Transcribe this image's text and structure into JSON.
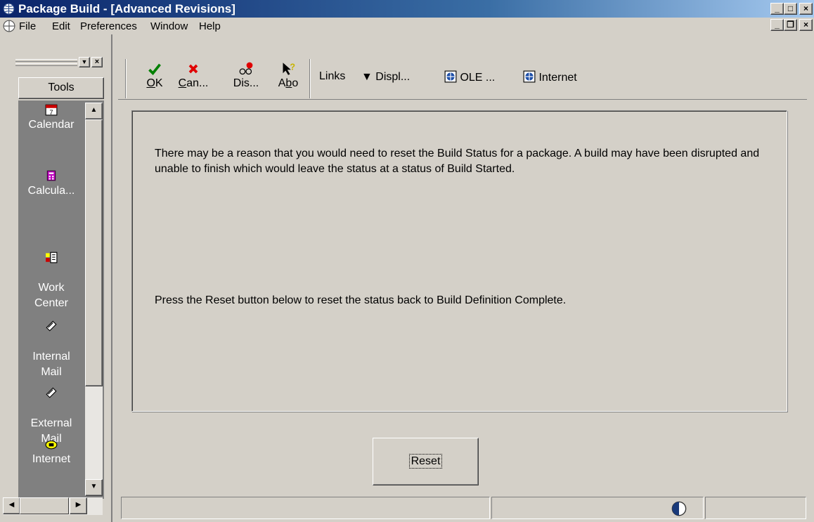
{
  "window": {
    "title": "Package Build - [Advanced Revisions]",
    "minimize_glyph": "_",
    "maximize_glyph": "□",
    "close_glyph": "×",
    "restore_glyph": "❐",
    "title_icon": "globe-icon"
  },
  "menu": {
    "items": [
      "File",
      "Edit",
      "Preferences",
      "Window",
      "Help"
    ]
  },
  "tools": {
    "header": "Tools",
    "items": [
      {
        "label": "Calendar",
        "icon": "calendar-icon"
      },
      {
        "label": "Calcula...",
        "icon": "calculator-icon"
      },
      {
        "label": "Work\nCenter",
        "icon": "work-center-icon"
      },
      {
        "label": "Internal\nMail",
        "icon": "mail-icon"
      },
      {
        "label": "External\nMail",
        "icon": "mail-icon"
      },
      {
        "label": "Internet",
        "icon": "phone-icon"
      }
    ]
  },
  "toolbar": {
    "ok": {
      "prefix": "",
      "mnemonic": "O",
      "rest": "K"
    },
    "cancel": {
      "prefix": "",
      "mnemonic": "C",
      "rest": "an..."
    },
    "display": {
      "label": "Dis..."
    },
    "about": {
      "prefix": "A",
      "mnemonic": "b",
      "rest": "o"
    },
    "links": "Links",
    "display_menu": "Displ...",
    "ole": "OLE ...",
    "internet": "Internet"
  },
  "content": {
    "paragraph1": "There may be a reason that you would need to reset the Build Status for a package.  A build may have been disrupted and unable to finish which would leave the status at a status of Build Started.",
    "paragraph2": "Press the Reset button below to reset the status back to Build Definition Complete.",
    "reset_button": "Reset"
  },
  "colors": {
    "face": "#d4d0c8",
    "title_start": "#0a246a",
    "check_green": "#008000",
    "cancel_red": "#e00000"
  }
}
